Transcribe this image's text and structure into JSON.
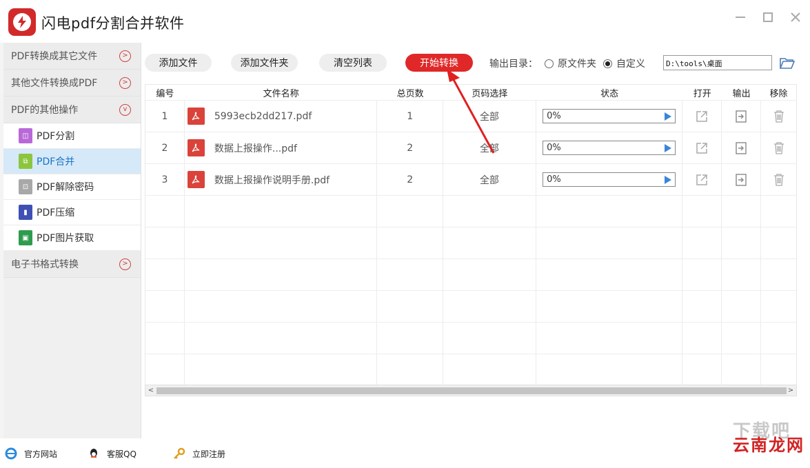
{
  "app": {
    "title": "闪电pdf分割合并软件",
    "accent": "#d22a2a"
  },
  "sidebar": {
    "cat1": "PDF转换成其它文件",
    "cat2": "其他文件转换成PDF",
    "cat3": "PDF的其他操作",
    "sub": [
      {
        "label": "PDF分割",
        "icon": "split-icon",
        "color": "#b968d8"
      },
      {
        "label": "PDF合并",
        "icon": "merge-icon",
        "color": "#8cc63e",
        "active": true
      },
      {
        "label": "PDF解除密码",
        "icon": "lock-icon",
        "color": "#a8a8a8"
      },
      {
        "label": "PDF压缩",
        "icon": "compress-icon",
        "color": "#3f50b5"
      },
      {
        "label": "PDF图片获取",
        "icon": "image-icon",
        "color": "#2e9c4d"
      }
    ],
    "cat4": "电子书格式转换"
  },
  "toolbar": {
    "add_file": "添加文件",
    "add_folder": "添加文件夹",
    "clear_list": "清空列表",
    "start": "开始转换",
    "output_label": "输出目录：",
    "radio_original": "原文件夹",
    "radio_custom": "自定义",
    "path": "D:\\tools\\桌面"
  },
  "table": {
    "headers": {
      "index": "编号",
      "name": "文件名称",
      "pages": "总页数",
      "range": "页码选择",
      "status": "状态",
      "open": "打开",
      "output": "输出",
      "remove": "移除"
    },
    "rows": [
      {
        "index": "1",
        "name": "5993ecb2dd217.pdf",
        "pages": "1",
        "range": "全部",
        "progress": "0%"
      },
      {
        "index": "2",
        "name": "数据上报操作...pdf",
        "pages": "2",
        "range": "全部",
        "progress": "0%"
      },
      {
        "index": "3",
        "name": "数据上报操作说明手册.pdf",
        "pages": "2",
        "range": "全部",
        "progress": "0%"
      }
    ]
  },
  "footer": {
    "website": "官方网站",
    "support": "客服QQ",
    "register": "立即注册"
  },
  "watermark": {
    "top": "下载吧",
    "bottom": "云南龙网"
  }
}
